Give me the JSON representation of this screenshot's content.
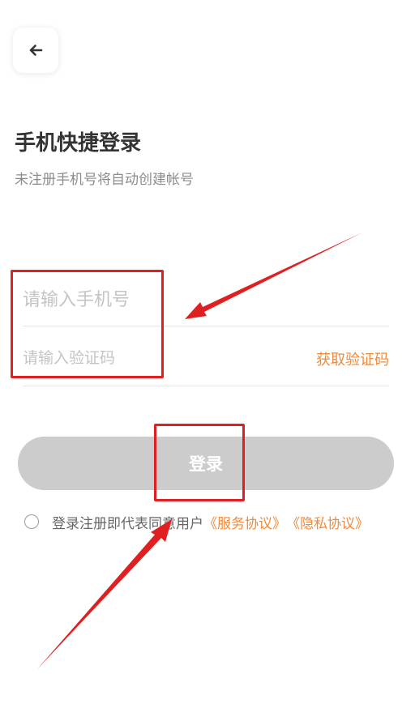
{
  "header": {
    "back_icon": "arrow-left-icon",
    "title": "手机快捷登录",
    "subtitle": "未注册手机号将自动创建帐号"
  },
  "form": {
    "phone_placeholder": "请输入手机号",
    "phone_value": "",
    "code_placeholder": "请输入验证码",
    "code_value": "",
    "get_code_label": "获取验证码",
    "login_label": "登录"
  },
  "agreement": {
    "checked": false,
    "text": "登录注册即代表同意用户",
    "service_link": "《服务协议》",
    "privacy_link": "《隐私协议》"
  },
  "colors": {
    "accent": "#f08a3c",
    "button_disabled": "#cccccc",
    "annotation": "#e02020"
  }
}
